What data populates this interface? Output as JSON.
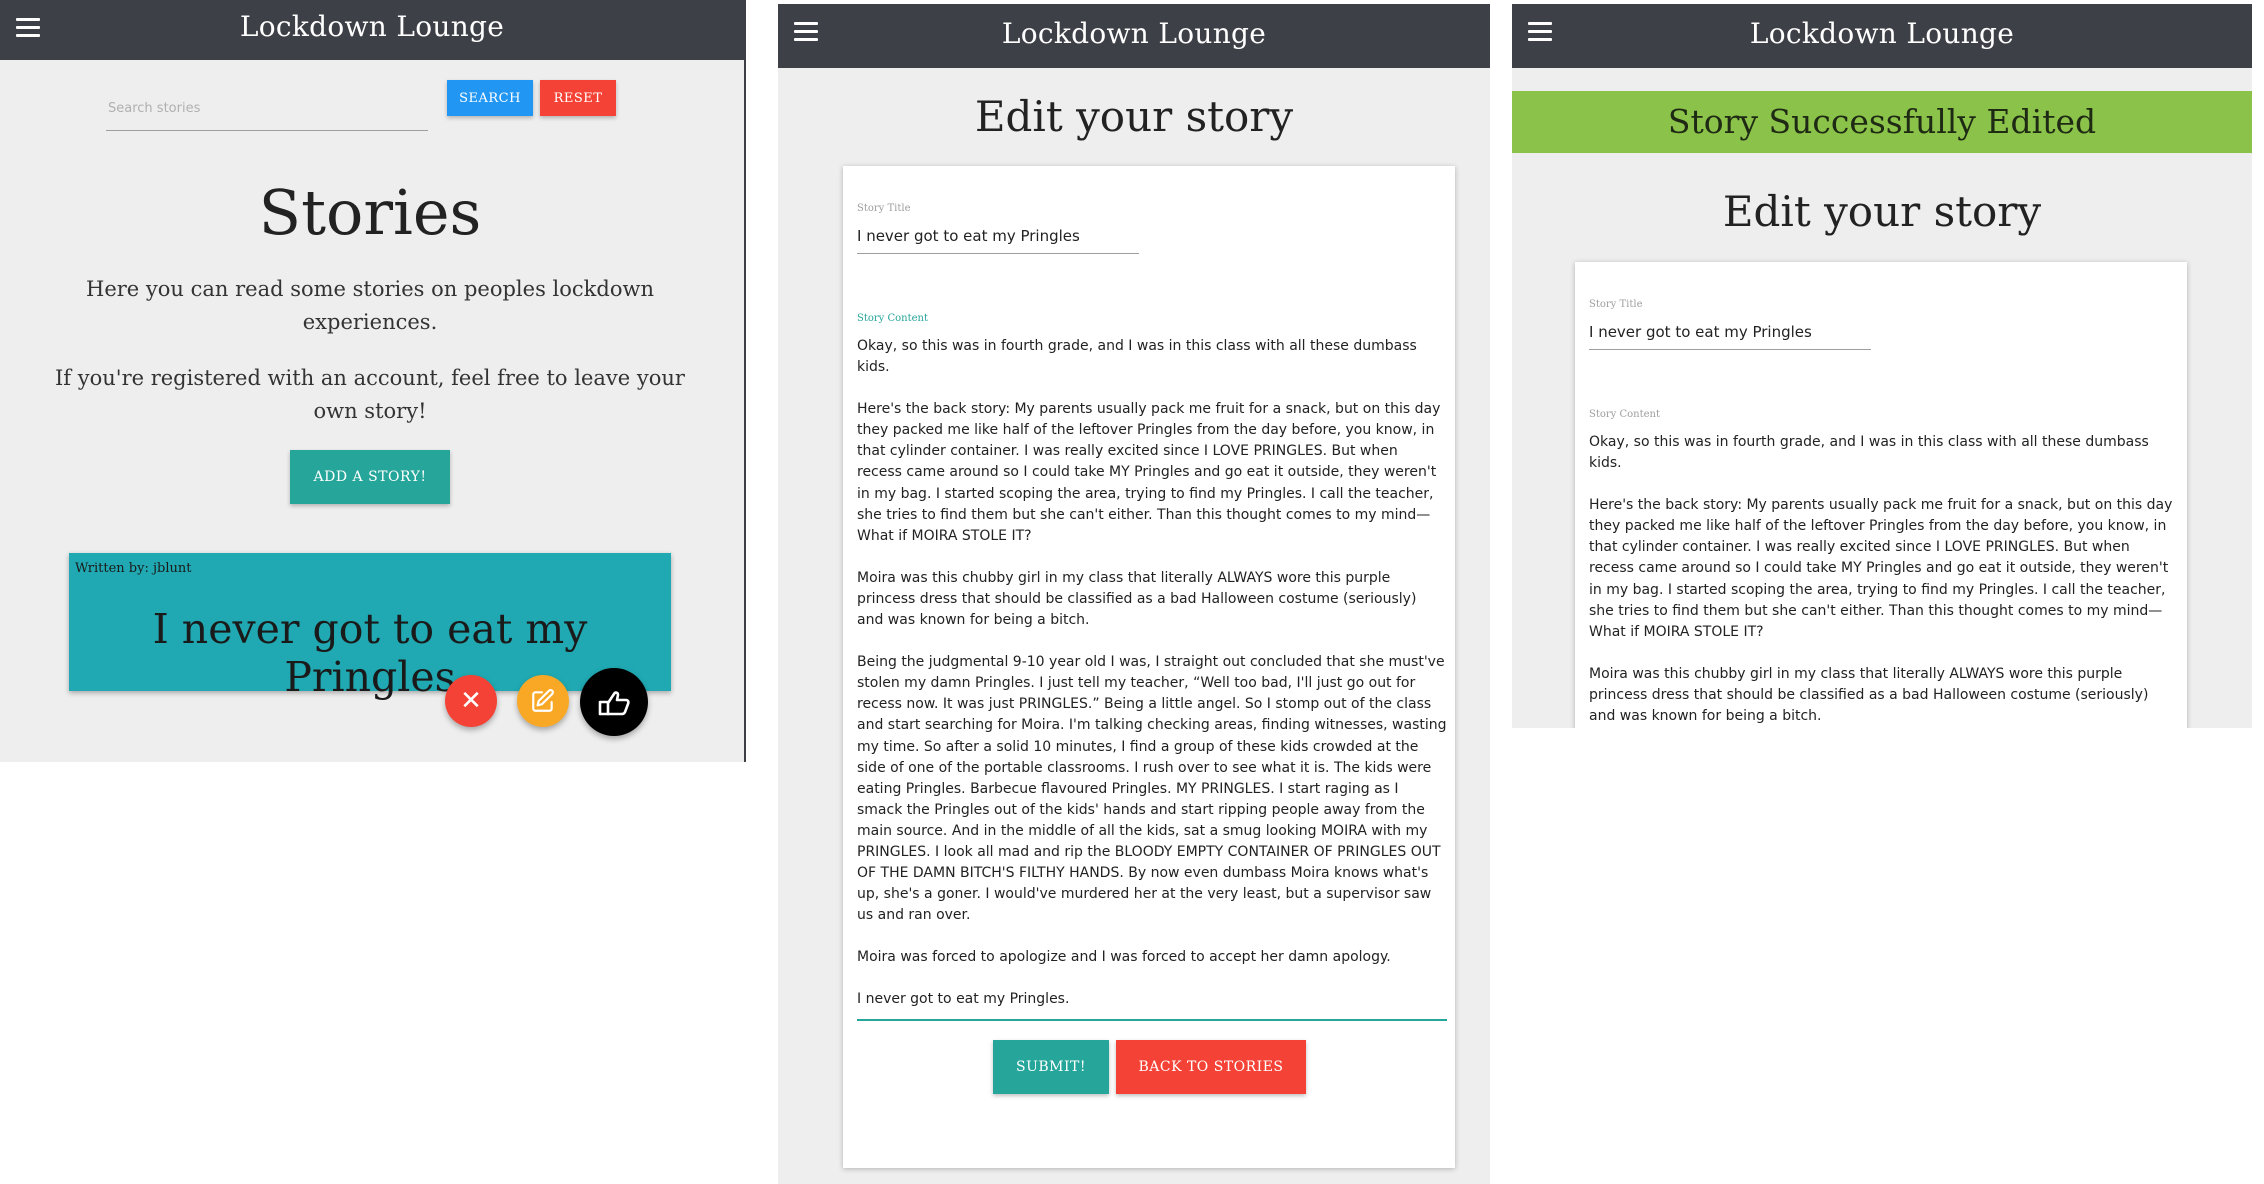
{
  "brand": "Lockdown Lounge",
  "list_view": {
    "search": {
      "placeholder": "Search stories",
      "value": ""
    },
    "search_label": "SEARCH",
    "reset_label": "RESET",
    "heading": "Stories",
    "intro_1": "Here you can read some stories on peoples lockdown experiences.",
    "intro_2": "If you're registered with an account, feel free to leave your own story!",
    "add_label": "ADD A STORY!",
    "card": {
      "author": "Written by: jblunt",
      "title": "I never got to eat my Pringles"
    }
  },
  "edit_view": {
    "heading": "Edit your story",
    "title_label": "Story Title",
    "title_value": "I never got to eat my Pringles",
    "content_label": "Story Content",
    "paragraphs": [
      "Okay, so this was in fourth grade, and I was in this class with all these dumbass kids.",
      "Here's the back story: My parents usually pack me fruit for a snack, but on this day they packed me like half of the leftover Pringles from the day before, you know, in that cylinder container. I was really excited since I LOVE PRINGLES. But when recess came around so I could take MY Pringles and go eat it outside, they weren't in my bag. I started scoping the area, trying to find my Pringles. I call the teacher, she tries to find them but she can't either. Than this thought comes to my mind— What if MOIRA STOLE IT?",
      "Moira was this chubby girl in my class that literally ALWAYS wore this purple princess dress that should be classified as a bad Halloween costume (seriously) and was known for being a bitch.",
      "Being the judgmental 9-10 year old I was, I straight out concluded that she must've stolen my damn Pringles. I just tell my teacher, “Well too bad, I'll just go out for recess now. It was just PRINGLES.” Being a little angel. So I stomp out of the class and start searching for Moira. I'm talking checking areas, finding witnesses, wasting my time. So after a solid 10 minutes, I find a group of these kids crowded at the side of one of the portable classrooms. I rush over to see what it is. The kids were eating Pringles. Barbecue flavoured Pringles. MY PRINGLES. I start raging as I smack the Pringles out of the kids' hands and start ripping people away from the main source. And in the middle of all the kids, sat a smug looking MOIRA with my PRINGLES. I look all mad and rip the BLOODY EMPTY CONTAINER OF PRINGLES OUT OF THE DAMN BITCH'S FILTHY HANDS. By now even dumbass Moira knows what's up, she's a goner. I would've murdered her at the very least, but a supervisor saw us and ran over.",
      "Moira was forced to apologize and I was forced to accept her damn apology.",
      "I never got to eat my Pringles."
    ],
    "submit_label": "SUBMIT!",
    "back_label": "BACK TO STORIES"
  },
  "success_view": {
    "banner": "Story Successfully Edited",
    "heading": "Edit your story",
    "title_label": "Story Title",
    "title_value": "I never got to eat my Pringles",
    "content_label": "Story Content",
    "paragraphs": [
      "Okay, so this was in fourth grade, and I was in this class with all these dumbass kids.",
      "Here's the back story: My parents usually pack me fruit for a snack, but on this day they packed me like half of the leftover Pringles from the day before, you know, in that cylinder container. I was really excited since I LOVE PRINGLES. But when recess came around so I could take MY Pringles and go eat it outside, they weren't in my bag. I started scoping the area, trying to find my Pringles. I call the teacher, she tries to find them but she can't either. Than this thought comes to my mind— What if MOIRA STOLE IT?",
      "Moira was this chubby girl in my class that literally ALWAYS wore this purple princess dress that should be classified as a bad Halloween costume (seriously) and was known for being a bitch."
    ]
  },
  "icons": {
    "menu": "hamburger-menu-icon",
    "delete": "close-icon",
    "edit": "edit-icon",
    "like": "pointing-hand-icon"
  },
  "colors": {
    "navbar": "#3e4047",
    "teal": "#26a69a",
    "card": "#20a9b2",
    "blue": "#2196f3",
    "red": "#f44336",
    "orange": "#f9a825",
    "success": "#8bc34a"
  }
}
